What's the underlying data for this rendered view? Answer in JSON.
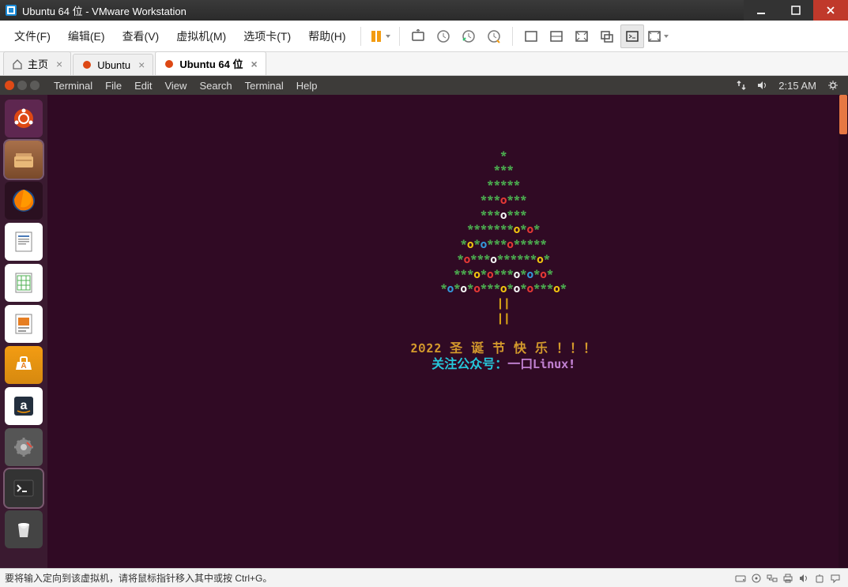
{
  "window": {
    "title": "Ubuntu 64 位 - VMware Workstation"
  },
  "vm_menu": {
    "items": [
      "文件(F)",
      "编辑(E)",
      "查看(V)",
      "虚拟机(M)",
      "选项卡(T)",
      "帮助(H)"
    ]
  },
  "vm_tabs": [
    {
      "label": "主页",
      "active": false,
      "icon": "home"
    },
    {
      "label": "Ubuntu",
      "active": false,
      "icon": "ubuntu"
    },
    {
      "label": "Ubuntu 64 位",
      "active": true,
      "icon": "ubuntu"
    }
  ],
  "ubuntu_menu": {
    "items": [
      "Terminal",
      "File",
      "Edit",
      "View",
      "Search",
      "Terminal",
      "Help"
    ],
    "time": "2:15 AM"
  },
  "launcher": [
    "dash",
    "files",
    "firefox",
    "writer",
    "calc",
    "impress",
    "software",
    "amazon",
    "settings",
    "terminal",
    "trash"
  ],
  "terminal": {
    "tree": [
      [
        {
          "t": "*",
          "c": "g"
        }
      ],
      [
        {
          "t": "***",
          "c": "g"
        }
      ],
      [
        {
          "t": "*****",
          "c": "g"
        }
      ],
      [
        {
          "t": "***",
          "c": "g"
        },
        {
          "t": "o",
          "c": "r"
        },
        {
          "t": "***",
          "c": "g"
        }
      ],
      [
        {
          "t": "***",
          "c": "g"
        },
        {
          "t": "o",
          "c": "w"
        },
        {
          "t": "***",
          "c": "g"
        }
      ],
      [
        {
          "t": "*******",
          "c": "g"
        },
        {
          "t": "o",
          "c": "y"
        },
        {
          "t": "*",
          "c": "g"
        },
        {
          "t": "o",
          "c": "r"
        },
        {
          "t": "*",
          "c": "g"
        }
      ],
      [
        {
          "t": "*",
          "c": "g"
        },
        {
          "t": "o",
          "c": "y"
        },
        {
          "t": "*",
          "c": "g"
        },
        {
          "t": "o",
          "c": "b"
        },
        {
          "t": "***",
          "c": "g"
        },
        {
          "t": "o",
          "c": "r"
        },
        {
          "t": "*****",
          "c": "g"
        }
      ],
      [
        {
          "t": "*",
          "c": "g"
        },
        {
          "t": "o",
          "c": "r"
        },
        {
          "t": "***",
          "c": "g"
        },
        {
          "t": "o",
          "c": "w"
        },
        {
          "t": "******",
          "c": "g"
        },
        {
          "t": "o",
          "c": "y"
        },
        {
          "t": "*",
          "c": "g"
        }
      ],
      [
        {
          "t": "***",
          "c": "g"
        },
        {
          "t": "o",
          "c": "y"
        },
        {
          "t": "*",
          "c": "g"
        },
        {
          "t": "o",
          "c": "r"
        },
        {
          "t": "***",
          "c": "g"
        },
        {
          "t": "o",
          "c": "w"
        },
        {
          "t": "*",
          "c": "g"
        },
        {
          "t": "o",
          "c": "b"
        },
        {
          "t": "*",
          "c": "g"
        },
        {
          "t": "o",
          "c": "r"
        },
        {
          "t": "*",
          "c": "g"
        }
      ],
      [
        {
          "t": "*",
          "c": "g"
        },
        {
          "t": "o",
          "c": "b"
        },
        {
          "t": "*",
          "c": "g"
        },
        {
          "t": "o",
          "c": "w"
        },
        {
          "t": "*",
          "c": "g"
        },
        {
          "t": "o",
          "c": "r"
        },
        {
          "t": "***",
          "c": "g"
        },
        {
          "t": "o",
          "c": "y"
        },
        {
          "t": "*",
          "c": "g"
        },
        {
          "t": "o",
          "c": "w"
        },
        {
          "t": "*",
          "c": "g"
        },
        {
          "t": "o",
          "c": "r"
        },
        {
          "t": "***",
          "c": "g"
        },
        {
          "t": "o",
          "c": "y"
        },
        {
          "t": "*",
          "c": "g"
        }
      ]
    ],
    "trunk": "||",
    "msg1": "2022 圣 诞 节 快 乐 ！！！",
    "msg2_a": "关注公众号：",
    "msg2_b": "一口Linux!"
  },
  "status": {
    "message": "要将输入定向到该虚拟机，请将鼠标指针移入其中或按 Ctrl+G。"
  }
}
